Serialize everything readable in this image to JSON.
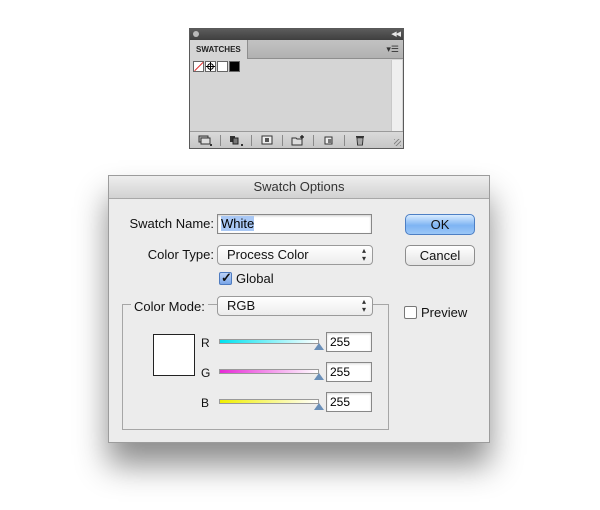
{
  "swatches_panel": {
    "tab_label": "SWATCHES",
    "swatches": [
      {
        "name": "None",
        "icon": "none-swatch-icon"
      },
      {
        "name": "Registration",
        "icon": "registration-target-icon"
      },
      {
        "name": "White",
        "color": "#ffffff"
      },
      {
        "name": "Black",
        "color": "#000000"
      }
    ],
    "bottom_icons": [
      "swatch-libraries-menu-icon",
      "show-swatch-kinds-icon",
      "swatch-options-icon",
      "new-color-group-icon",
      "new-swatch-icon",
      "delete-swatch-icon"
    ]
  },
  "dialog": {
    "title": "Swatch Options",
    "swatch_name_label": "Swatch Name:",
    "swatch_name_value": "White",
    "color_type_label": "Color Type:",
    "color_type_value": "Process Color",
    "global_label": "Global",
    "global_checked": true,
    "color_mode_label": "Color Mode:",
    "color_mode_value": "RGB",
    "preview_label": "Preview",
    "preview_checked": false,
    "ok_label": "OK",
    "cancel_label": "Cancel",
    "channels": [
      {
        "label": "R",
        "value": "255"
      },
      {
        "label": "G",
        "value": "255"
      },
      {
        "label": "B",
        "value": "255"
      }
    ],
    "colors": {
      "default_button": "#7eb4f3",
      "selection": "#a9c8f5",
      "preview_color": "#ffffff"
    }
  }
}
